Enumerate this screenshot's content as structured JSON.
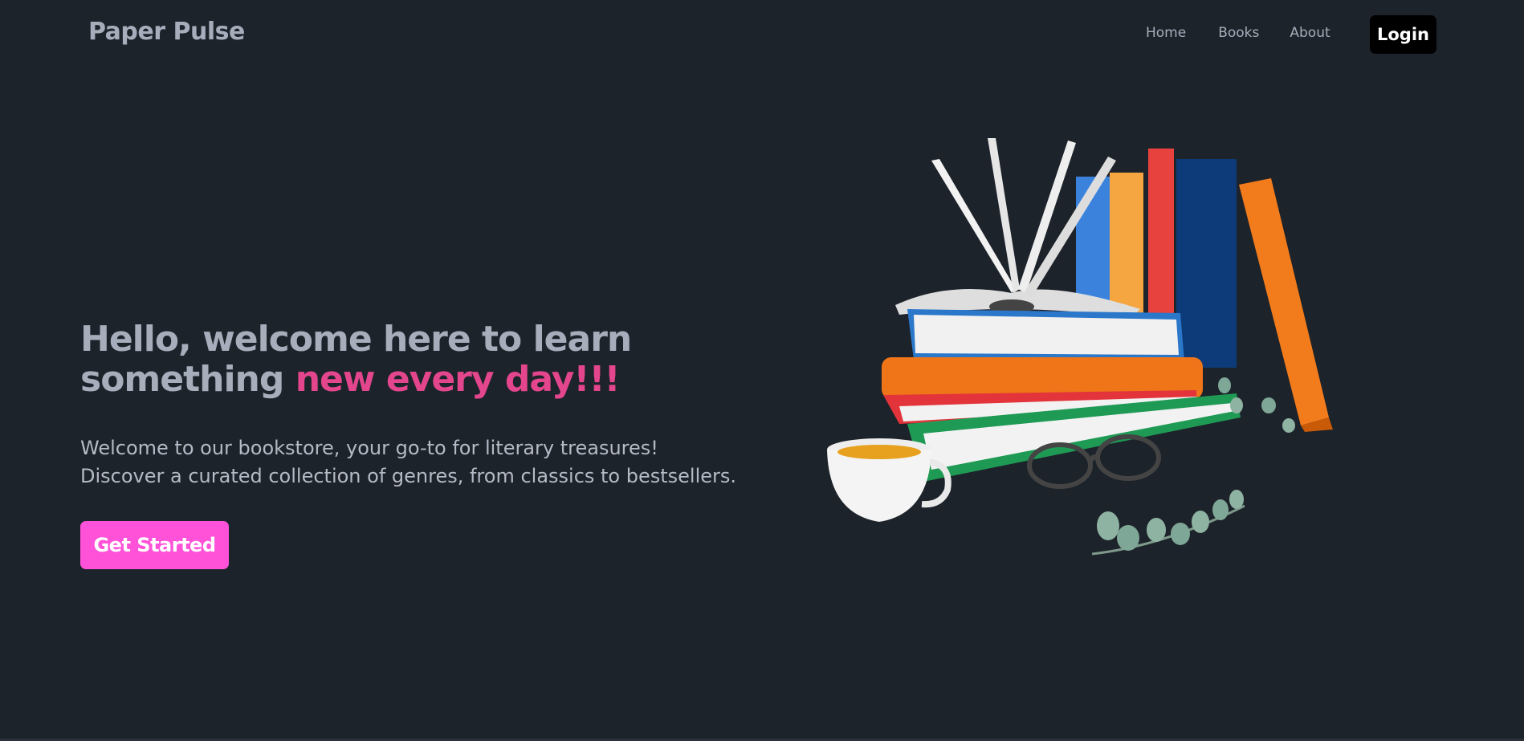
{
  "navbar": {
    "brand": "Paper Pulse",
    "links": [
      "Home",
      "Books",
      "About"
    ],
    "login_label": "Login"
  },
  "hero": {
    "title_part1": "Hello, welcome here to learn something ",
    "title_accent": "new every day!!!",
    "line1": "Welcome to our bookstore, your go-to for literary treasures!",
    "line2": "Discover a curated collection of genres, from classics to bestsellers.",
    "cta_label": "Get Started"
  },
  "colors": {
    "background": "#1d232a",
    "accent_text": "#e3468d",
    "cta_background": "#ff52d9",
    "login_background": "#000000"
  },
  "icons": [
    "books-illustration"
  ]
}
